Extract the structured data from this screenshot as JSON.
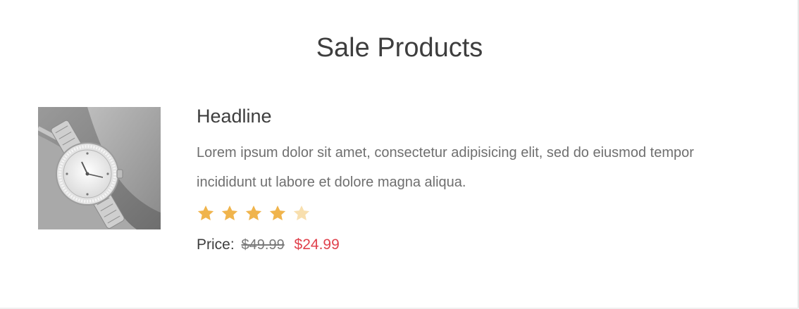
{
  "section": {
    "title": "Sale Products"
  },
  "product": {
    "image_icon": "wristwatch-photo",
    "headline": "Headline",
    "description": "Lorem ipsum dolor sit amet, consectetur adipisicing elit, sed do eiusmod tempor incididunt ut labore et dolore magna aliqua.",
    "rating": {
      "value": 4,
      "max": 5,
      "filled_color": "#f0b44c",
      "empty_color": "#f8dfae"
    },
    "price": {
      "label": "Price:",
      "old": "$49.99",
      "new": "$24.99",
      "new_color": "#e0424d"
    }
  }
}
